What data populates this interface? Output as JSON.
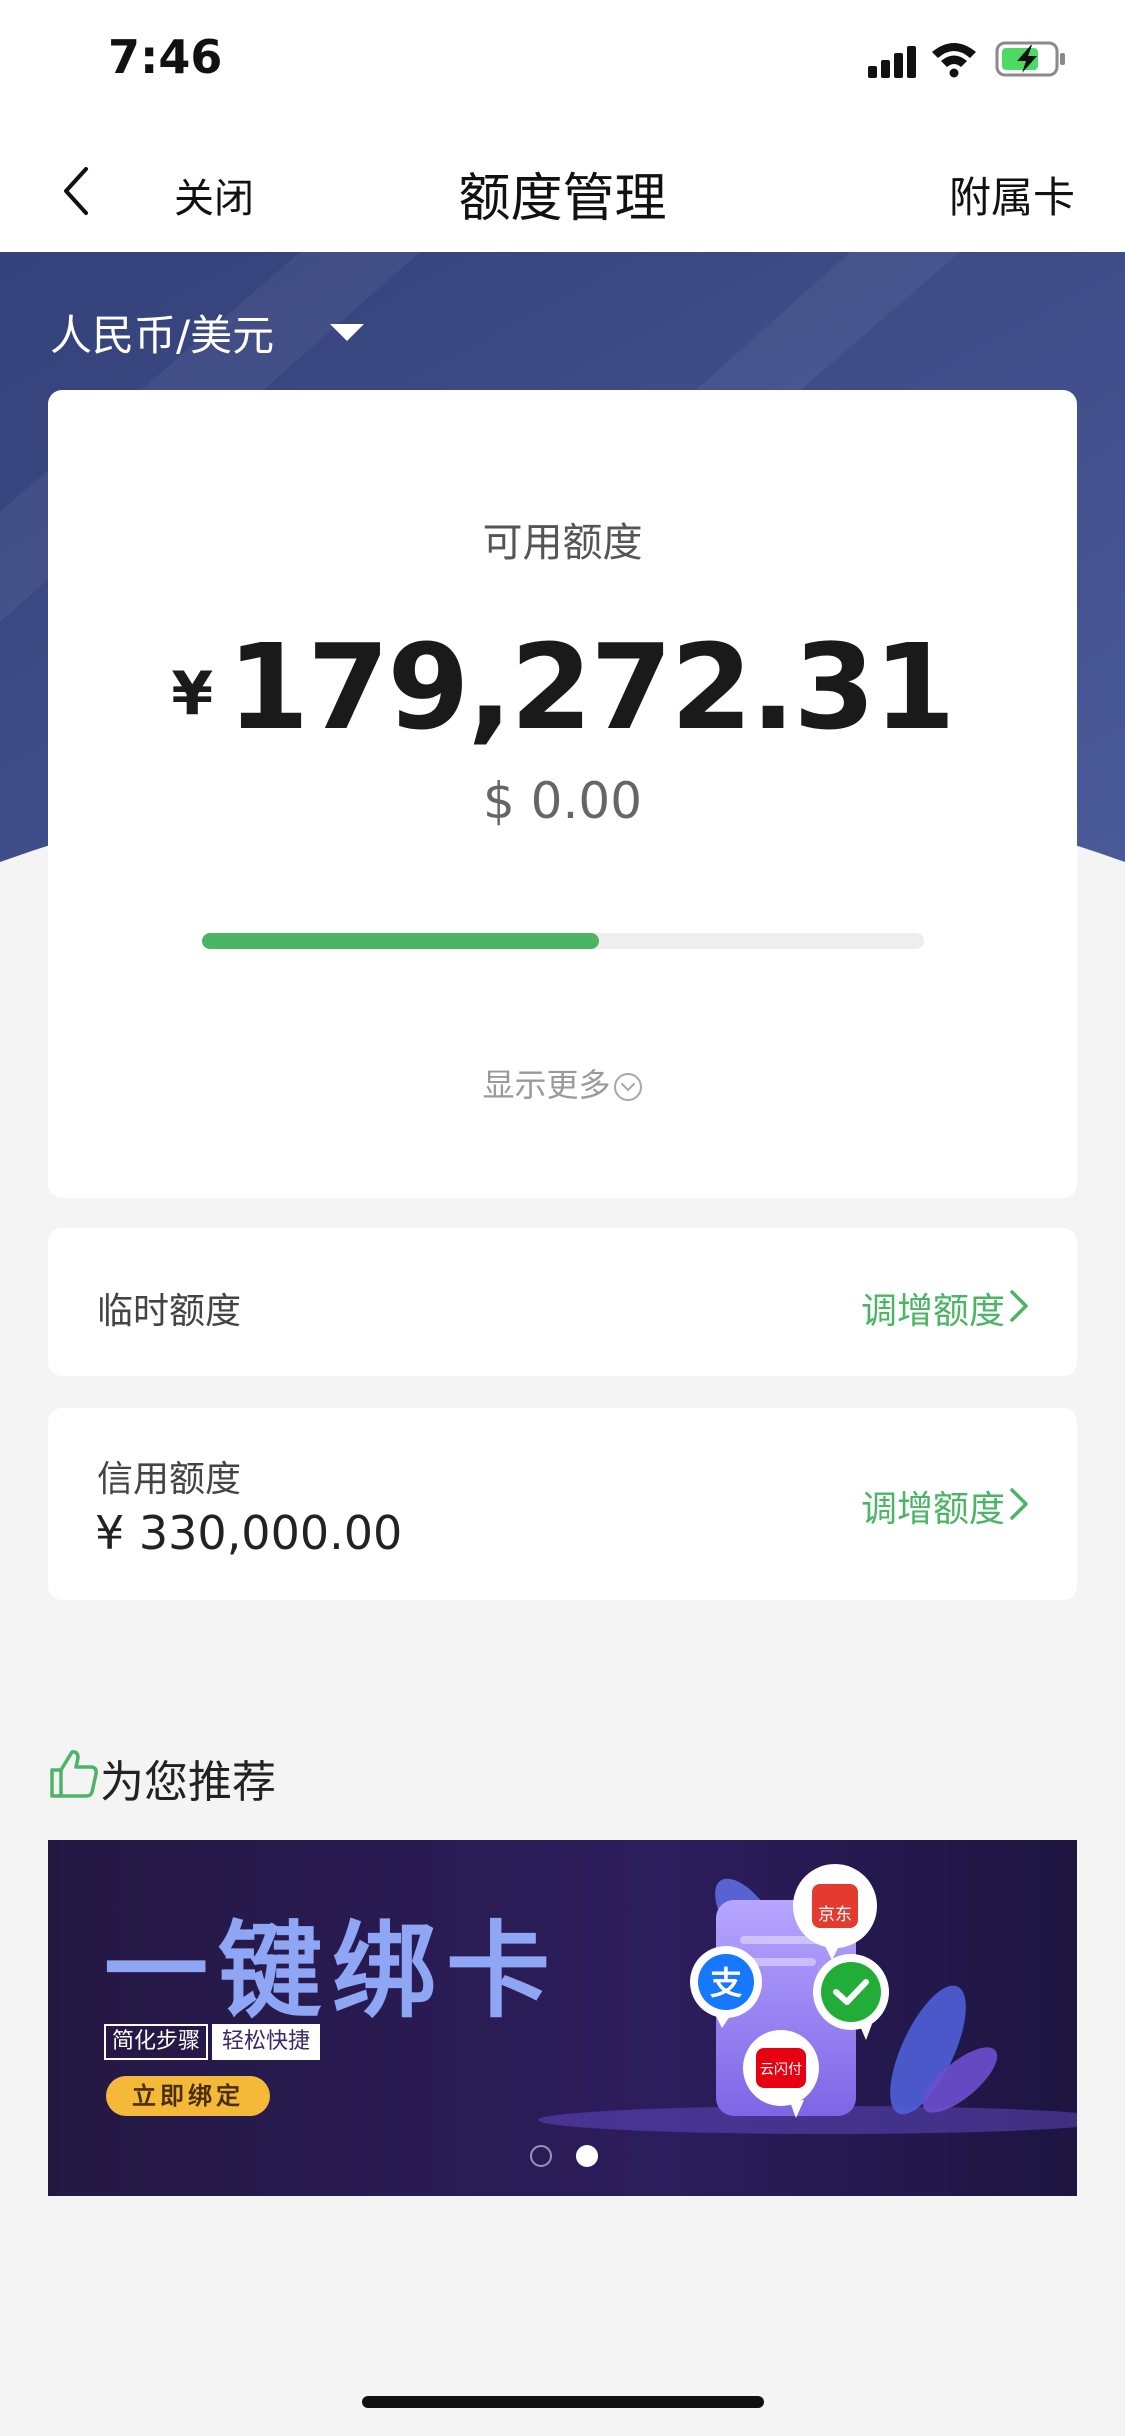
{
  "status_bar": {
    "time": "7:46"
  },
  "nav": {
    "close_label": "关闭",
    "title": "额度管理",
    "supplementary_card": "附属卡"
  },
  "currency": {
    "selected": "人民币/美元"
  },
  "available": {
    "label": "可用额度",
    "cny_symbol": "¥",
    "cny_amount": "179,272.31",
    "usd_amount": "$ 0.00",
    "progress_fraction": 0.55,
    "show_more": "显示更多"
  },
  "temporary_limit": {
    "label": "临时额度",
    "action": "调增额度"
  },
  "credit_limit": {
    "label": "信用额度",
    "amount": "¥ 330,000.00",
    "action": "调增额度"
  },
  "recommend": {
    "title": "为您推荐",
    "banner": {
      "title": "一键绑卡",
      "tag_1": "简化步骤",
      "tag_2": "轻松快捷",
      "button": "立即绑定",
      "slides": 2,
      "active_slide": 2,
      "icons": [
        "jd-icon",
        "alipay-icon",
        "wechat-pay-icon",
        "unionpay-cloud-icon"
      ],
      "icon_texts": {
        "jd": "京东",
        "unionpay_cloud": "云闪付"
      }
    }
  },
  "colors": {
    "accent_green": "#4cb565",
    "hero_navy": "#3b4a85",
    "banner_bg": "#261a4d"
  }
}
